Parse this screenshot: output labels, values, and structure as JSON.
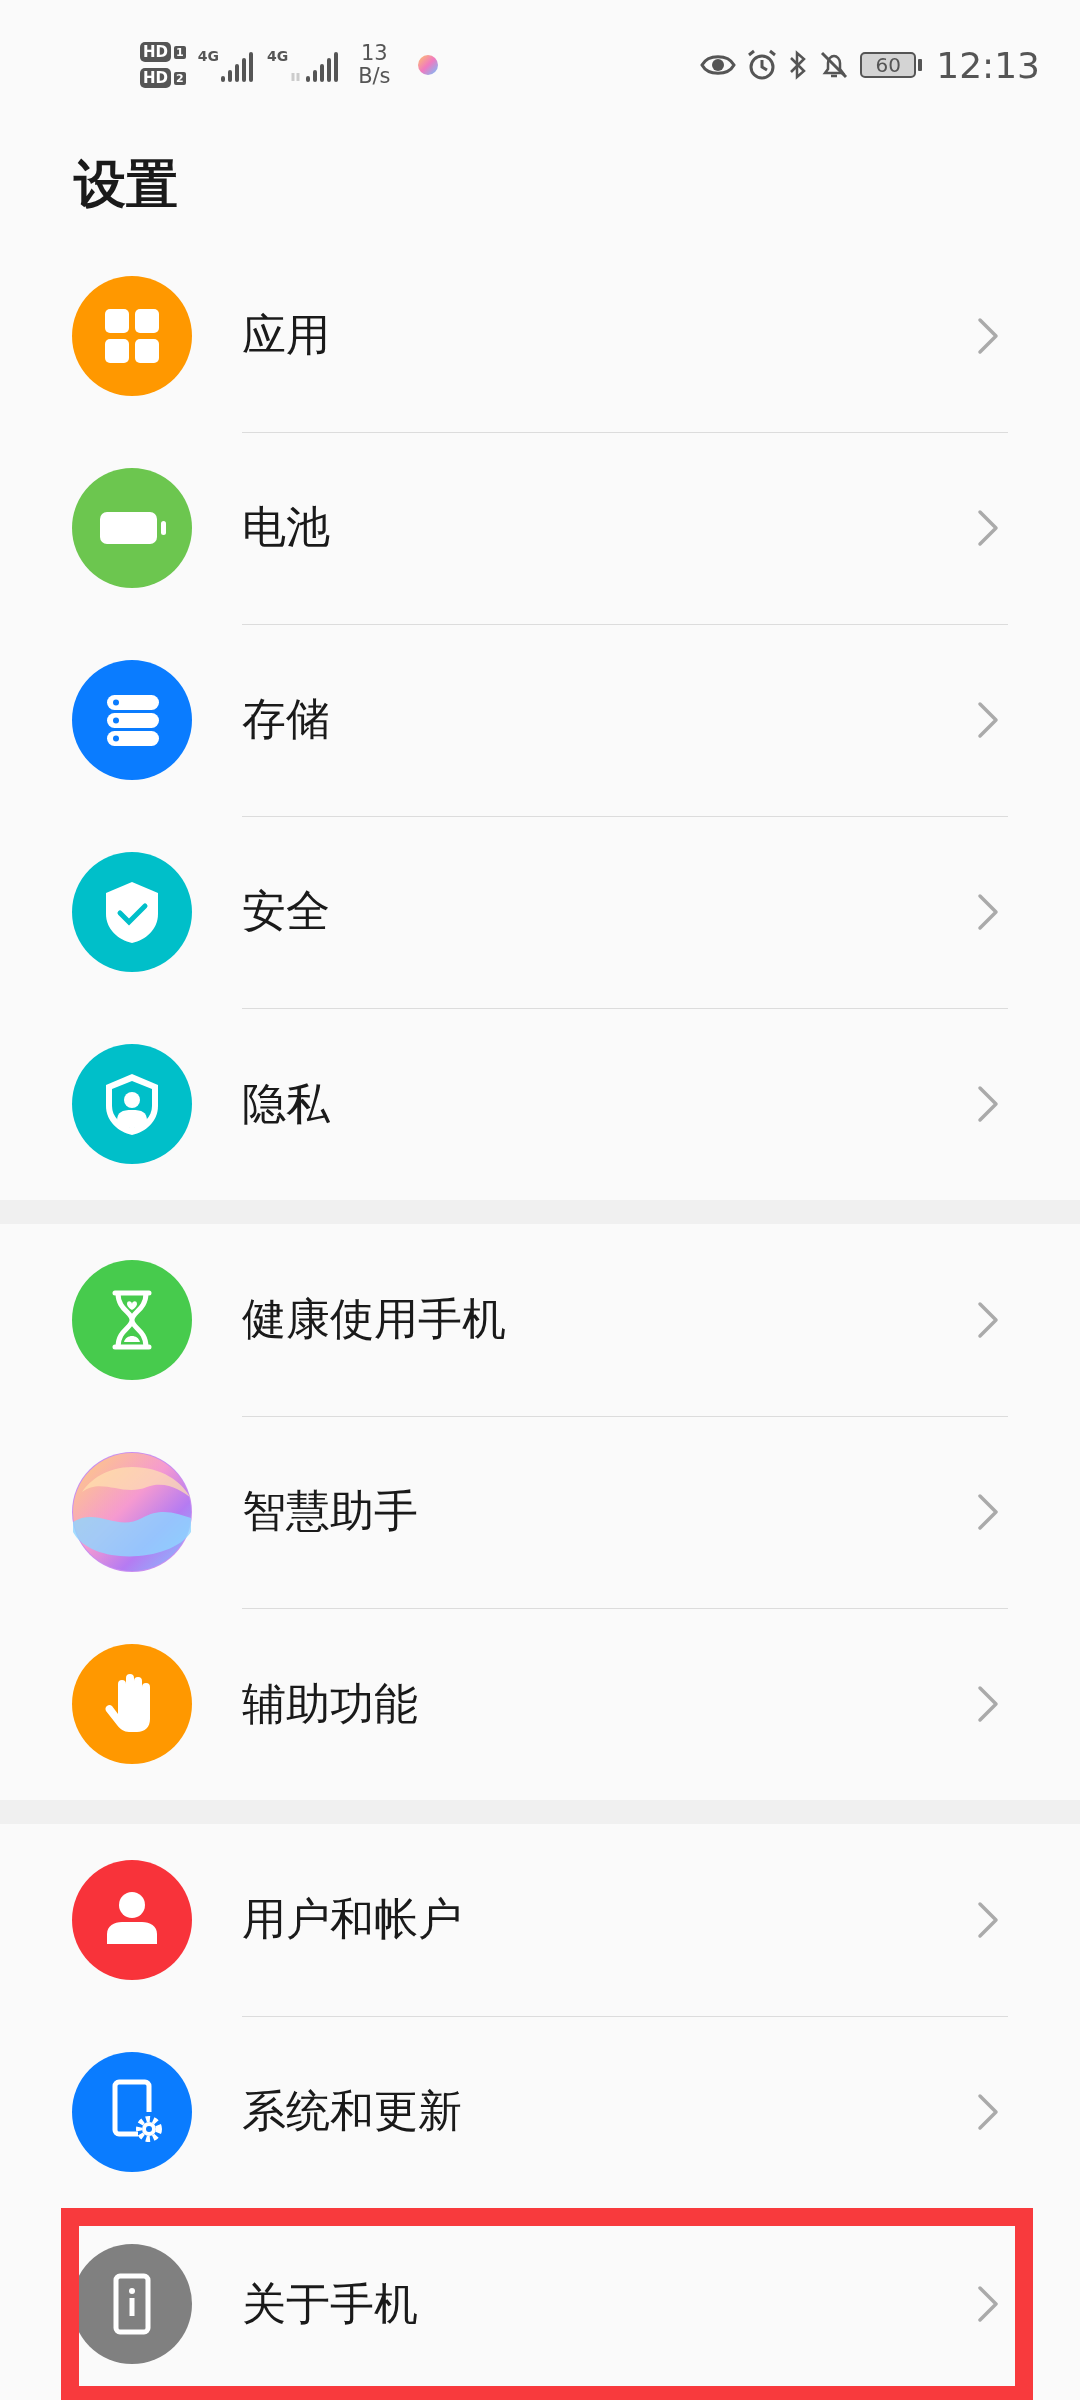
{
  "status_bar": {
    "sim_slots": [
      {
        "badge": "HD",
        "slot": "1"
      },
      {
        "badge": "HD",
        "slot": "2"
      }
    ],
    "networks": [
      {
        "type": "4G"
      },
      {
        "type": "4G"
      }
    ],
    "speed_value": "13",
    "speed_unit": "B/s",
    "battery": "60",
    "time": "12:13"
  },
  "title": "设置",
  "groups": [
    {
      "items": [
        {
          "label": "应用",
          "kind": "apps",
          "color": "#ff9800",
          "highlighted": false
        },
        {
          "label": "电池",
          "kind": "battery",
          "color": "#6cc64f",
          "highlighted": false
        },
        {
          "label": "存储",
          "kind": "storage",
          "color": "#0a7cff",
          "highlighted": false
        },
        {
          "label": "安全",
          "kind": "security",
          "color": "#00bfc9",
          "highlighted": false
        },
        {
          "label": "隐私",
          "kind": "privacy",
          "color": "#00bfc9",
          "highlighted": false
        }
      ]
    },
    {
      "items": [
        {
          "label": "健康使用手机",
          "kind": "hourglass",
          "color": "#47cb4d",
          "highlighted": false
        },
        {
          "label": "智慧助手",
          "kind": "assistant",
          "color": "#c98ef0",
          "highlighted": false
        },
        {
          "label": "辅助功能",
          "kind": "hand",
          "color": "#ff9800",
          "highlighted": false
        }
      ]
    },
    {
      "items": [
        {
          "label": "用户和帐户",
          "kind": "user",
          "color": "#f8333a",
          "highlighted": false
        },
        {
          "label": "系统和更新",
          "kind": "system",
          "color": "#0a7cff",
          "highlighted": false
        },
        {
          "label": "关于手机",
          "kind": "about",
          "color": "#808080",
          "highlighted": true
        }
      ]
    }
  ]
}
